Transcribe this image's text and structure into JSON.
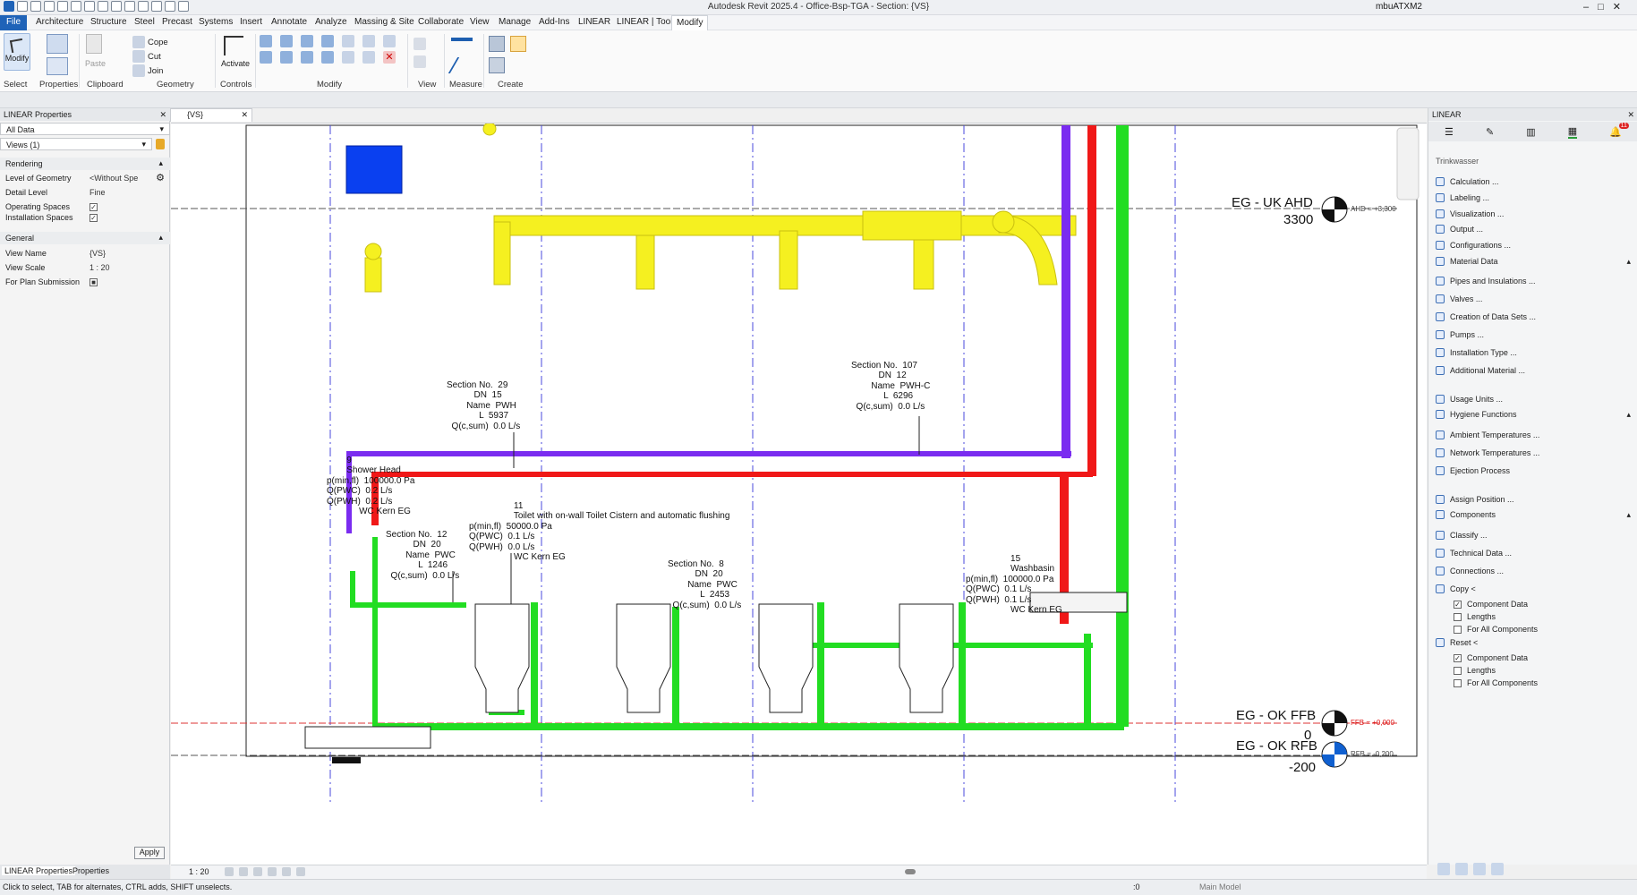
{
  "window": {
    "title": "Autodesk Revit 2025.4 - Office-Bsp-TGA - Section: {VS}",
    "user": "mbuATXM2"
  },
  "menu": [
    "File",
    "Architecture",
    "Structure",
    "Steel",
    "Precast",
    "Systems",
    "Insert",
    "Annotate",
    "Analyze",
    "Massing & Site",
    "Collaborate",
    "View",
    "Manage",
    "Add-Ins",
    "LINEAR",
    "LINEAR | Tools",
    "Modify"
  ],
  "ribbon": {
    "modify": "Modify",
    "select": "Select",
    "properties": "Properties",
    "clipboard": "Clipboard",
    "paste": "Paste",
    "cope": "Cope",
    "cut": "Cut",
    "join": "Join",
    "geometry": "Geometry",
    "activate": "Activate",
    "controls": "Controls",
    "modify_group": "Modify",
    "view": "View",
    "measure": "Measure",
    "create": "Create"
  },
  "left_panel": {
    "title": "LINEAR Properties",
    "filter": "All Data",
    "views": "Views (1)",
    "rendering_header": "Rendering",
    "level_of_geometry_label": "Level of Geometry",
    "level_of_geometry_value": "<Without Spe",
    "detail_level_label": "Detail Level",
    "detail_level_value": "Fine",
    "operating_spaces_label": "Operating Spaces",
    "installation_spaces_label": "Installation Spaces",
    "general_header": "General",
    "view_name_label": "View Name",
    "view_name_value": "{VS}",
    "view_scale_label": "View Scale",
    "view_scale_value": "1 : 20",
    "plan_submission_label": "For Plan Submission",
    "apply": "Apply",
    "tab_linear": "LINEAR Properties",
    "tab_properties": "Properties"
  },
  "view_tab": "{VS}",
  "levels": {
    "uk_ahd": {
      "name": "EG - UK AHD",
      "value": "3300",
      "tag": "AHD = +3,300"
    },
    "ok_ffb": {
      "name": "EG - OK FFB",
      "value": "0",
      "tag": "FFB = +0,000"
    },
    "ok_rfb": {
      "name": "EG - OK RFB",
      "value": "-200",
      "tag": "RFB = -0,200"
    }
  },
  "annotations": {
    "sec29": "Section No.  29\n           DN  15\n        Name  PWH\n             L  5937\n  Q(c,sum)  0.0 L/s",
    "sec107": "Section No.  107\n           DN  12\n        Name  PWH-C\n             L  6296\n  Q(c,sum)  0.0 L/s",
    "shower": "        9\n        Shower Head\np(min,fl)  100000.0 Pa\nQ(PWC)  0.2 L/s\nQ(PWH)  0.2 L/s\n             WC Kern EG",
    "toilet": "                  11\n                  Toilet with on-wall Toilet Cistern and automatic flushing\np(min,fl)  50000.0 Pa\nQ(PWC)  0.1 L/s\nQ(PWH)  0.0 L/s\n                  WC Kern EG",
    "sec12": "Section No.  12\n           DN  20\n        Name  PWC\n             L  1246\n  Q(c,sum)  0.0 L/s",
    "sec8": "Section No.  8\n           DN  20\n        Name  PWC\n             L  2453\n  Q(c,sum)  0.0 L/s",
    "washbasin": "                  15\n                  Washbasin\np(min,fl)  100000.0 Pa\nQ(PWC)  0.1 L/s\nQ(PWH)  0.1 L/s\n                  WC Kern EG"
  },
  "right_panel": {
    "title": "LINEAR",
    "section": "Trinkwasser",
    "items": [
      "Calculation ...",
      "Labeling ...",
      "Visualization ...",
      "Output ...",
      "Configurations ..."
    ],
    "material_header": "Material Data",
    "material_items": [
      "Pipes and Insulations ...",
      "Valves ...",
      "Creation of Data Sets ...",
      "Pumps ...",
      "Installation Type ...",
      "Additional Material ..."
    ],
    "usage_units": "Usage Units ...",
    "hygiene_header": "Hygiene Functions",
    "hygiene_items": [
      "Ambient Temperatures ...",
      "Network Temperatures ...",
      "Ejection Process"
    ],
    "assign_position": "Assign Position ...",
    "components_header": "Components",
    "component_items": [
      "Classify ...",
      "Technical Data ...",
      "Connections ..."
    ],
    "copy": "Copy <",
    "reset": "Reset <",
    "check_component_data": "Component Data",
    "check_lengths": "Lengths",
    "check_all_components": "For All Components",
    "badge": "11"
  },
  "view_bar": {
    "scale": "1 : 20"
  },
  "status": {
    "hint": "Click to select, TAB for alternates, CTRL adds, SHIFT unselects.",
    "model": "Main Model",
    "zero": ":0"
  }
}
